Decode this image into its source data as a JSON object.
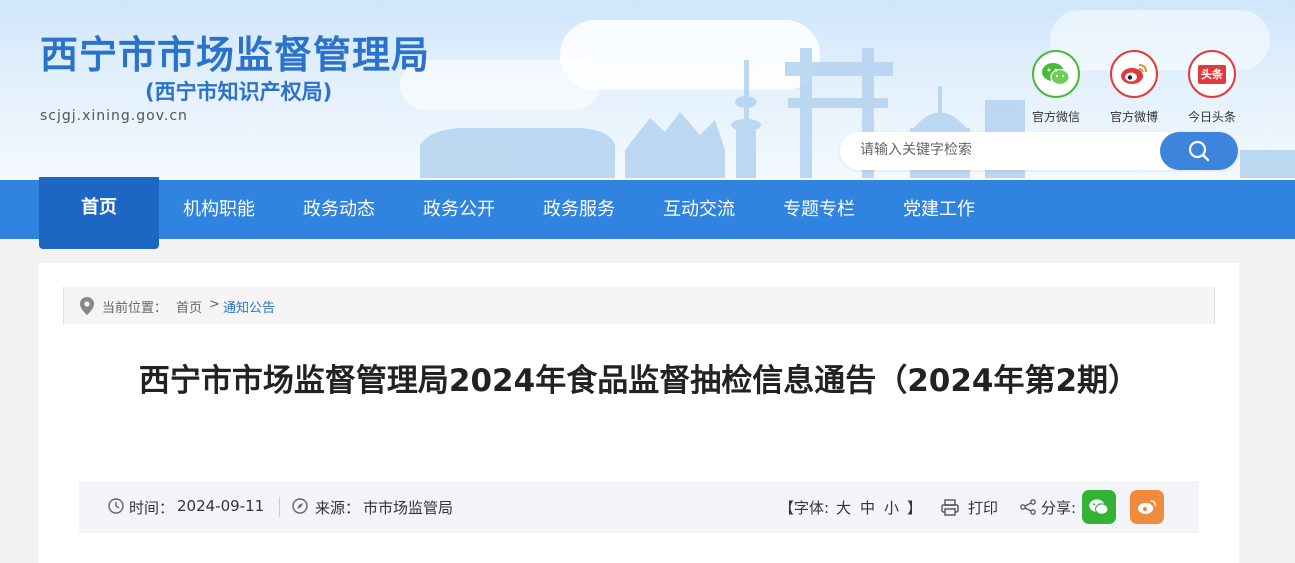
{
  "site": {
    "title": "西宁市市场监督管理局",
    "subtitle": "(西宁市知识产权局)",
    "url": "scjgj.xining.gov.cn"
  },
  "social": [
    {
      "label": "官方微信",
      "icon": "wechat-icon",
      "color": "#4cb93a"
    },
    {
      "label": "官方微博",
      "icon": "weibo-icon",
      "color": "#e4393c"
    },
    {
      "label": "今日头条",
      "icon": "toutiao-icon",
      "text": "头条",
      "color": "#e4393c"
    }
  ],
  "search": {
    "placeholder": "请输入关键字检索"
  },
  "nav": {
    "items": [
      "首页",
      "机构职能",
      "政务动态",
      "政务公开",
      "政务服务",
      "互动交流",
      "专题专栏",
      "党建工作"
    ],
    "active": "首页"
  },
  "breadcrumb": {
    "label": "当前位置：",
    "home": "首页",
    "separator": ">",
    "current": "通知公告"
  },
  "article": {
    "title": "西宁市市场监督管理局2024年食品监督抽检信息通告（2024年第2期）",
    "time_label": "时间：",
    "time_value": "2024-09-11",
    "source_label": "来源：",
    "source_value": "市市场监管局",
    "font_label_open": "【字体:",
    "font_large": "大",
    "font_medium": "中",
    "font_small": "小",
    "font_label_close": "】",
    "print_label": "打印",
    "share_label": "分享:"
  },
  "colors": {
    "brand": "#2a72cc",
    "nav": "#3183e0",
    "nav_active": "#1e66c4",
    "wechat": "#34b233",
    "weibo": "#f08a3c"
  }
}
